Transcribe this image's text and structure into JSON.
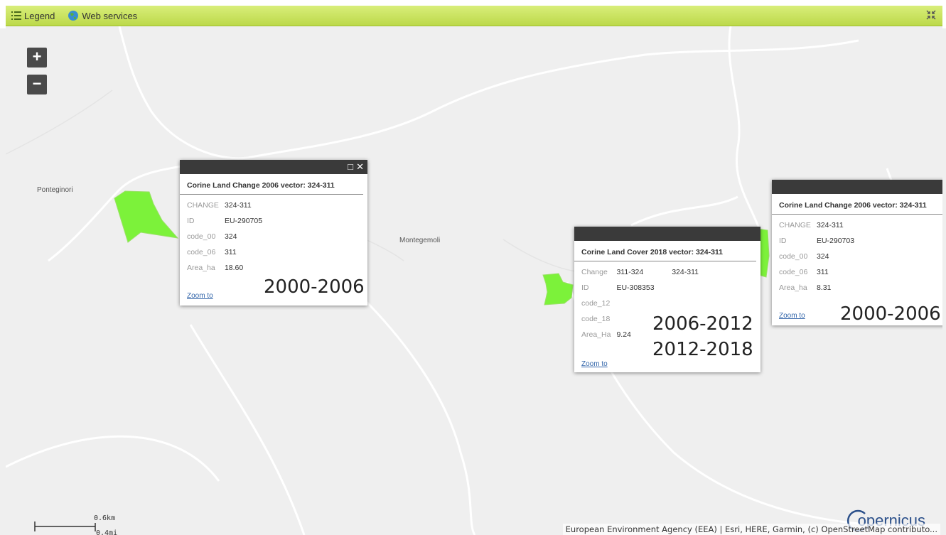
{
  "toolbar": {
    "legend_label": "Legend",
    "web_services_label": "Web services"
  },
  "zoom": {
    "in": "+",
    "out": "−"
  },
  "places": {
    "ponteginori": "Ponteginori",
    "montegemoli": "Montegemoli"
  },
  "popup1": {
    "title": "Corine Land Change 2006 vector: 324-311",
    "rows": [
      {
        "key": "CHANGE",
        "value": "324-311"
      },
      {
        "key": "ID",
        "value": "EU-290705"
      },
      {
        "key": "code_00",
        "value": "324"
      },
      {
        "key": "code_06",
        "value": "311"
      },
      {
        "key": "Area_ha",
        "value": "18.60"
      }
    ],
    "zoom_label": "Zoom to",
    "period": "2000-2006"
  },
  "popup2": {
    "title": "Corine Land Cover 2018 vector: 324-311",
    "change_key": "Change",
    "change_vals": [
      "311-324",
      "324-311"
    ],
    "rows": [
      {
        "key": "ID",
        "value": "EU-308353"
      },
      {
        "key": "code_12",
        "value": ""
      },
      {
        "key": "code_18",
        "value": ""
      },
      {
        "key": "Area_Ha",
        "value": "9.24"
      }
    ],
    "zoom_label": "Zoom to",
    "period_a": "2006-2012",
    "period_b": "2012-2018"
  },
  "popup3": {
    "title": "Corine Land Change 2006 vector: 324-311",
    "rows": [
      {
        "key": "CHANGE",
        "value": "324-311"
      },
      {
        "key": "ID",
        "value": "EU-290703"
      },
      {
        "key": "code_00",
        "value": "324"
      },
      {
        "key": "code_06",
        "value": "311"
      },
      {
        "key": "Area_ha",
        "value": "8.31"
      }
    ],
    "zoom_label": "Zoom to",
    "period": "2000-2006"
  },
  "scale": {
    "km": "0.6km",
    "mi": "0.4mi"
  },
  "logo_text": "opernicus",
  "attribution": "European Environment Agency (EEA) | Esri, HERE, Garmin, (c) OpenStreetMap contributo...",
  "colors": {
    "polygon": "#7cf23a",
    "toolbar": "#c8e35a",
    "popup_header": "#3a3a3a"
  }
}
